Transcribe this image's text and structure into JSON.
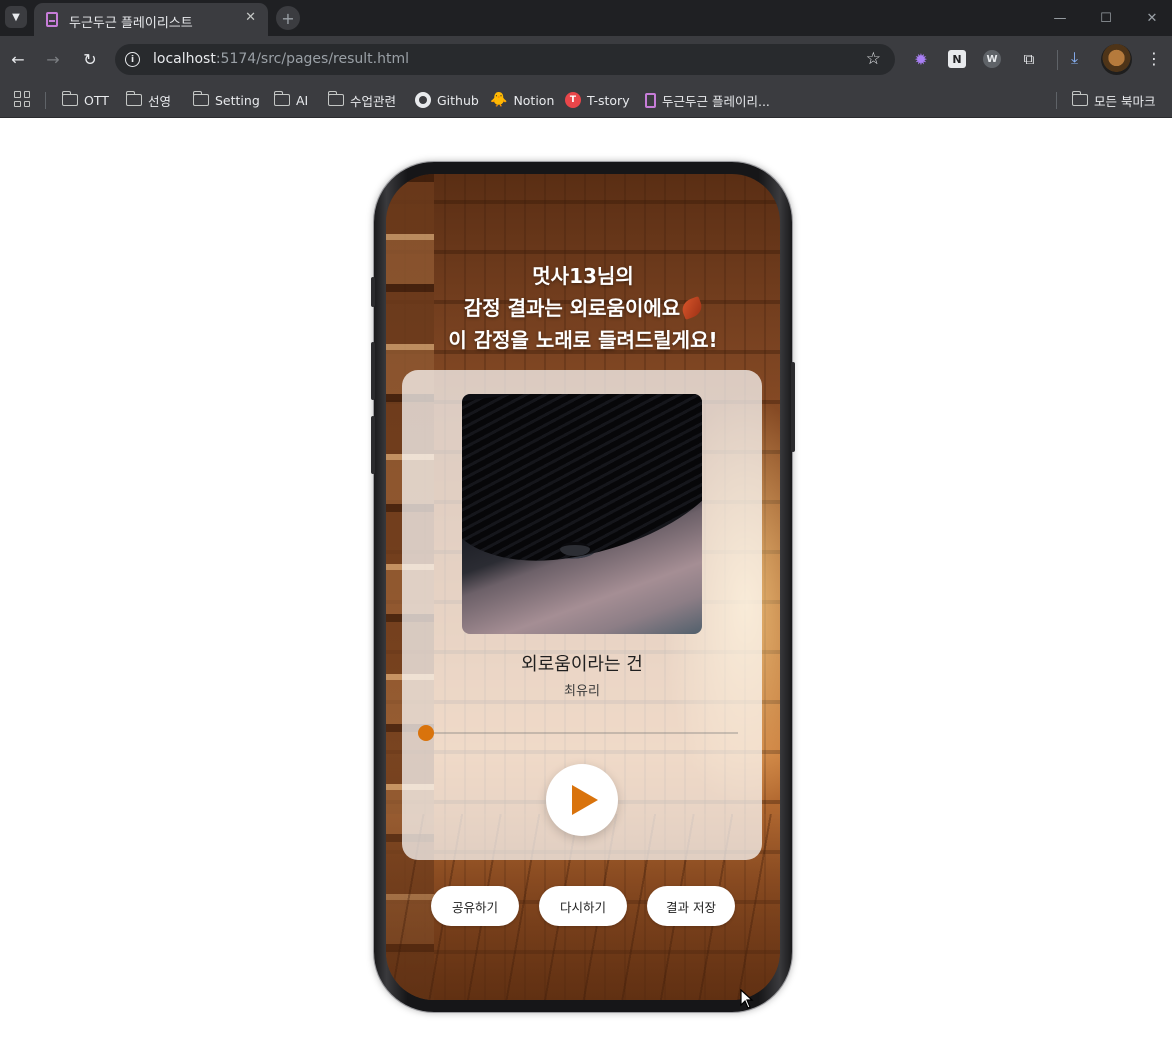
{
  "browser": {
    "tab_title": "두근두근 플레이리스트",
    "tab_close": "✕",
    "new_tab": "+",
    "url_host": "localhost",
    "url_path": ":5174/src/pages/result.html",
    "window_min": "—",
    "window_max": "☐",
    "window_close": "✕"
  },
  "bookmarks": {
    "items": [
      {
        "label": "OTT",
        "icon": "folder-icon"
      },
      {
        "label": "선영",
        "icon": "folder-icon"
      },
      {
        "label": "Setting",
        "icon": "folder-icon"
      },
      {
        "label": "AI",
        "icon": "folder-icon"
      },
      {
        "label": "수업관련",
        "icon": "folder-icon"
      },
      {
        "label": "Github",
        "icon": "github-icon"
      },
      {
        "label": "Notion",
        "icon": "notion-icon"
      },
      {
        "label": "T-story",
        "icon": "tstory-icon"
      },
      {
        "label": "두근두근 플레이리...",
        "icon": "page-icon"
      }
    ],
    "all_bookmarks": "모든 북마크"
  },
  "result": {
    "headline_line1": "멋사13님의",
    "headline_line2": "감정 결과는 외로움이에요",
    "headline_line3": "이 감정을 노래로 들려드릴게요!",
    "emotion_icon": "leaf-icon"
  },
  "player": {
    "song_title": "외로움이라는 건",
    "artist": "최유리",
    "progress": 0.0,
    "accent_color": "#d9730c"
  },
  "actions": {
    "share": "공유하기",
    "retry": "다시하기",
    "save": "결과 저장"
  }
}
